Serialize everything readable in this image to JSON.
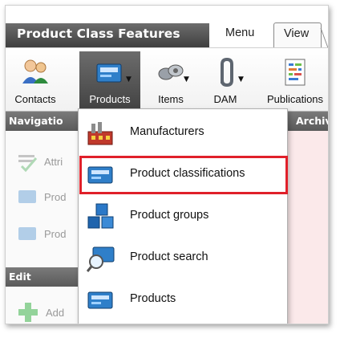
{
  "window": {
    "title": "Product Class Features"
  },
  "tabs": [
    {
      "label": "Menu"
    },
    {
      "label": "View"
    }
  ],
  "ribbon": {
    "buttons": [
      {
        "label": "Contacts",
        "icon": "contacts-icon"
      },
      {
        "label": "Products",
        "icon": "products-icon",
        "active": true
      },
      {
        "label": "Items",
        "icon": "items-icon"
      },
      {
        "label": "DAM",
        "icon": "paperclip-icon"
      },
      {
        "label": "Publications",
        "icon": "publications-icon"
      }
    ]
  },
  "panels": {
    "navigation": {
      "header": "Navigatio",
      "items": [
        {
          "label": "Attri"
        },
        {
          "label": "Prod"
        },
        {
          "label": "Prod"
        }
      ]
    },
    "archive": {
      "header": "Archiv"
    },
    "edit": {
      "header": "Edit",
      "add_label": "Add"
    }
  },
  "dropdown": {
    "items": [
      {
        "label": "Manufacturers",
        "icon": "factory-icon"
      },
      {
        "label": "Product classifications",
        "icon": "product-box-icon",
        "highlighted": true
      },
      {
        "label": "Product groups",
        "icon": "cubes-icon"
      },
      {
        "label": "Product search",
        "icon": "magnifier-box-icon"
      },
      {
        "label": "Products",
        "icon": "product-box-icon"
      }
    ]
  },
  "colors": {
    "highlight_border": "#e0202a",
    "title_bg": "#4d4d4d",
    "archive_pane": "#fbe9ea"
  }
}
